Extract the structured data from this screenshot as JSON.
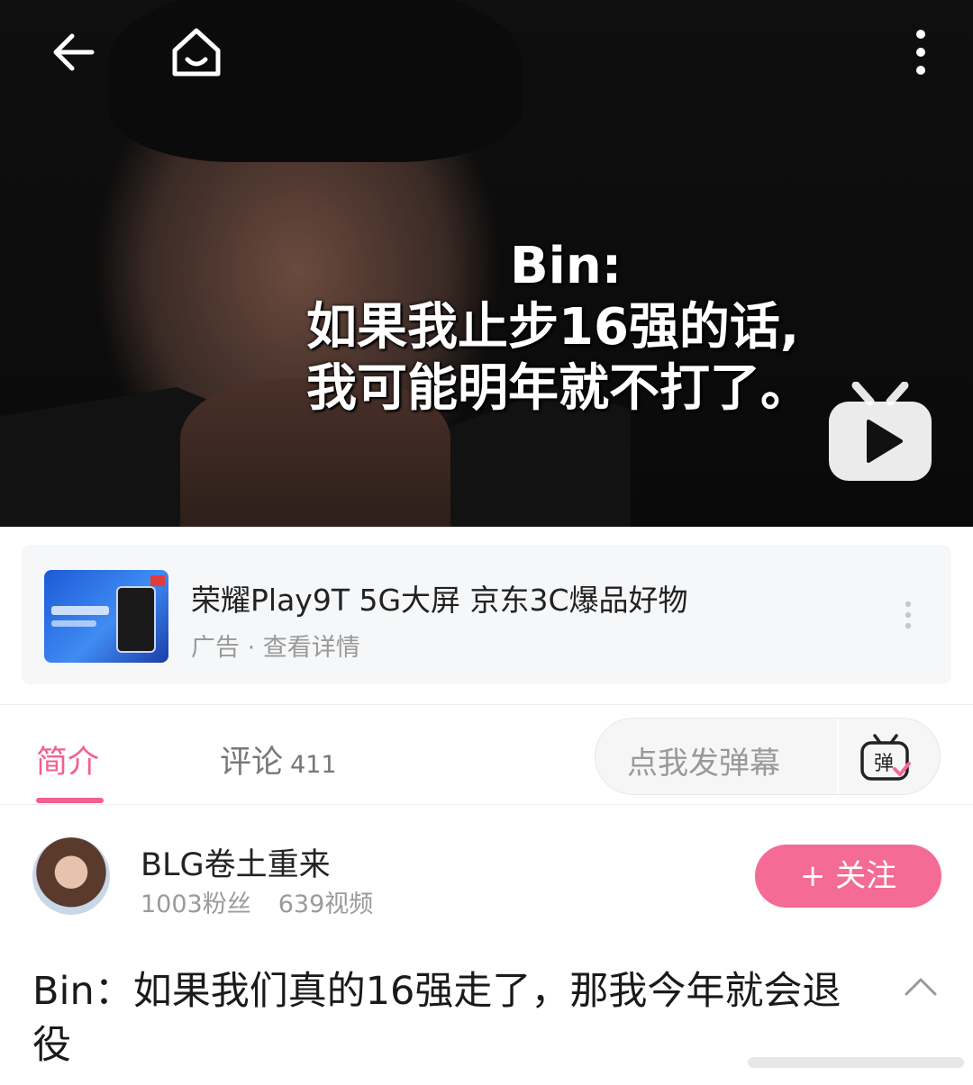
{
  "video": {
    "subtitle_line1": "Bin:",
    "subtitle_line2": "如果我止步16强的话,",
    "subtitle_line3": "我可能明年就不打了。"
  },
  "icons": {
    "back": "back-arrow-icon",
    "home": "home-icon",
    "more": "more-vertical-icon",
    "play": "tv-play-icon",
    "danmaku": "danmaku-icon",
    "collapse": "chevron-up-icon"
  },
  "ad": {
    "title": "荣耀Play9T 5G大屏 京东3C爆品好物",
    "subtitle": "广告 · 查看详情"
  },
  "tabs": {
    "intro": "简介",
    "comments": "评论",
    "comments_count": "411"
  },
  "danmaku": {
    "placeholder": "点我发弹幕",
    "button_glyph": "弹"
  },
  "uploader": {
    "name": "BLG卷土重来",
    "fans": "1003粉丝",
    "videos": "639视频",
    "follow_label": "+ 关注"
  },
  "description": {
    "text": "Bin：如果我们真的16强走了，那我今年就会退役"
  },
  "colors": {
    "accent": "#f46b96",
    "tab_active": "#f2608f"
  }
}
